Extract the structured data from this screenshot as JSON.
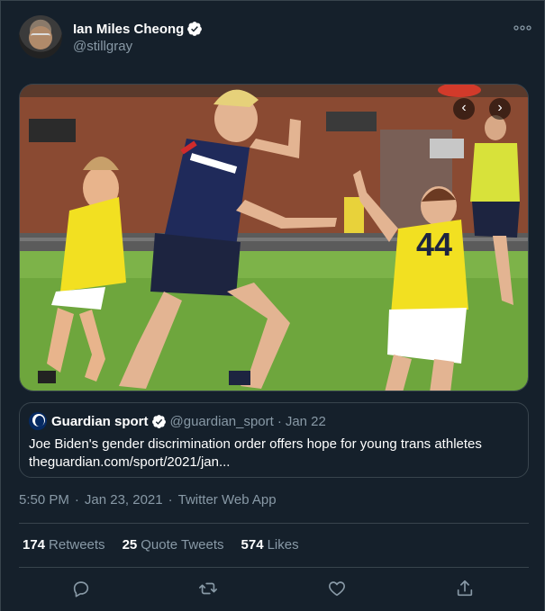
{
  "author": {
    "display_name": "Ian Miles Cheong",
    "handle": "@stillgray",
    "verified": true
  },
  "media": {
    "player_number": "44",
    "has_carousel": true
  },
  "quote": {
    "display_name": "Guardian sport",
    "handle": "@guardian_sport",
    "separator": "·",
    "date": "Jan 22",
    "text": "Joe Biden's gender discrimination order offers hope for young trans athletes",
    "link": "theguardian.com/sport/2021/jan..."
  },
  "meta": {
    "time": "5:50 PM",
    "date": "Jan 23, 2021",
    "source": "Twitter Web App",
    "separator": "·"
  },
  "stats": {
    "retweets_count": "174",
    "retweets_label": "Retweets",
    "quote_count": "25",
    "quote_label": "Quote Tweets",
    "likes_count": "574",
    "likes_label": "Likes"
  },
  "icons": {
    "more": "more-horizontal-icon",
    "reply": "reply-icon",
    "retweet": "retweet-icon",
    "like": "heart-icon",
    "share": "share-icon"
  },
  "colors": {
    "background": "#15202b",
    "border": "#38444d",
    "secondary_text": "#8899a6",
    "verified": "#ffffff",
    "jersey_yellow": "#f2e021"
  }
}
